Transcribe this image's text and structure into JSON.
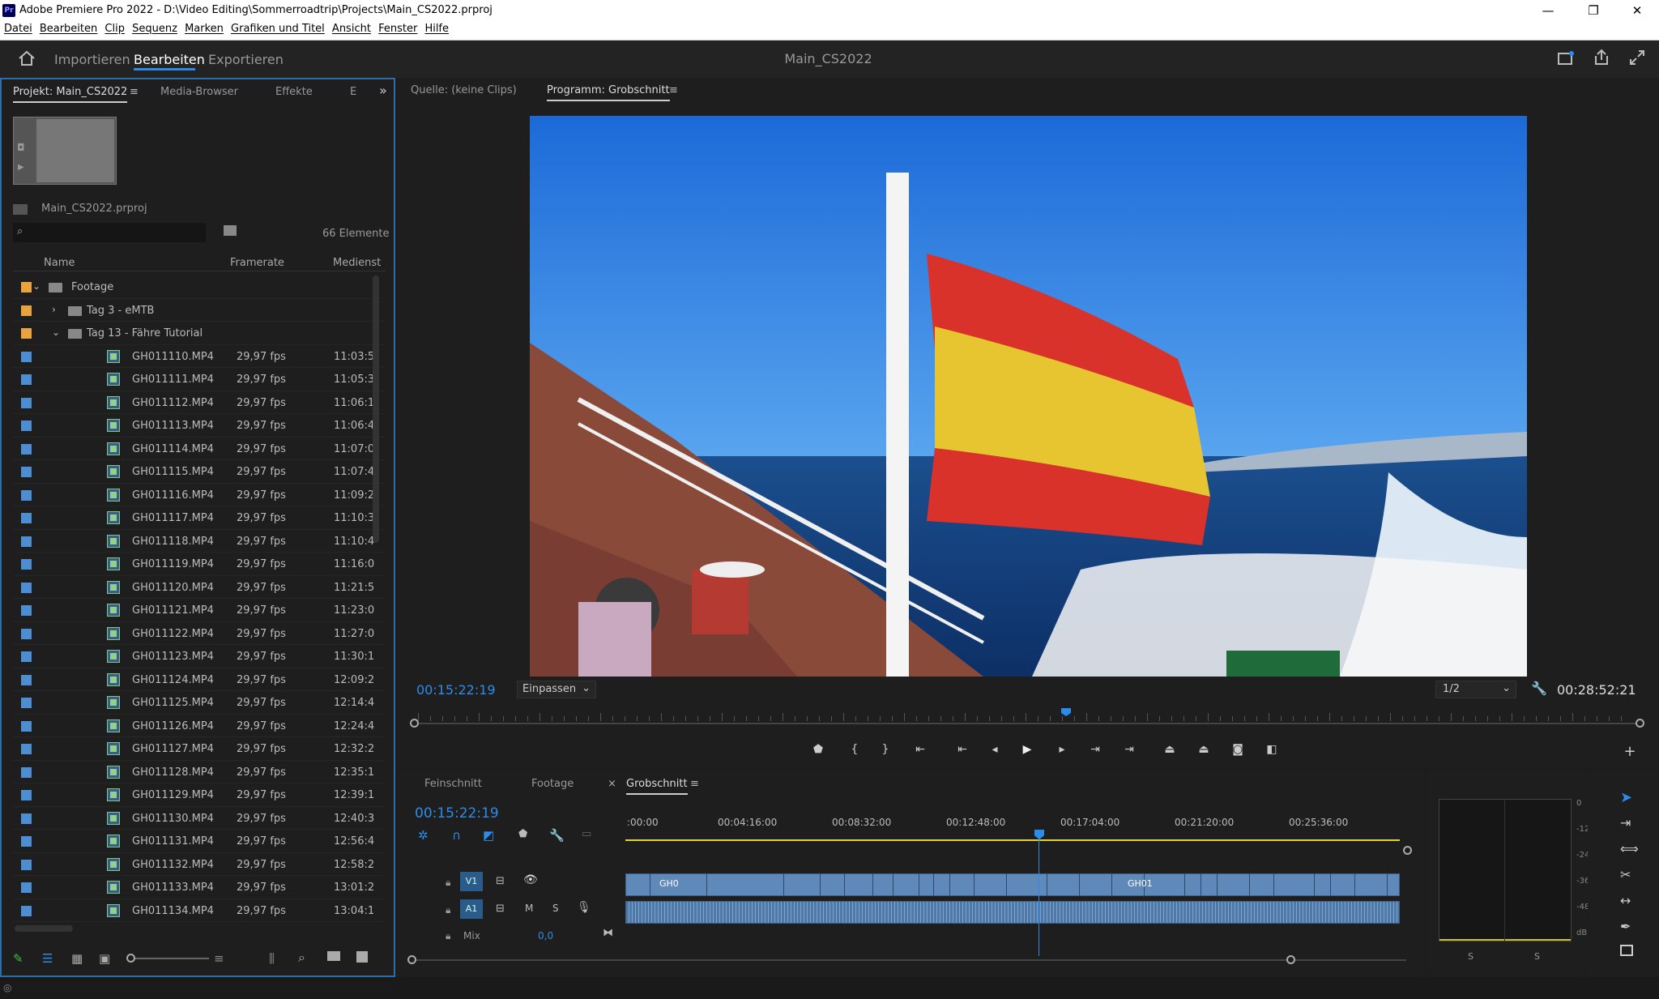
{
  "app": {
    "title": "Adobe Premiere Pro 2022 - D:\\Video Editing\\Sommerroadtrip\\Projects\\Main_CS2022.prproj",
    "logo_text": "Pr"
  },
  "window_controls": {
    "minimize": "—",
    "maximize": "❐",
    "close": "✕"
  },
  "menu": [
    "Datei",
    "Bearbeiten",
    "Clip",
    "Sequenz",
    "Marken",
    "Grafiken und Titel",
    "Ansicht",
    "Fenster",
    "Hilfe"
  ],
  "workspaces": {
    "import": "Importieren",
    "edit": "Bearbeiten",
    "export": "Exportieren"
  },
  "doc_title": "Main_CS2022",
  "project_panel": {
    "tabs": [
      "Projekt: Main_CS2022",
      "Media-Browser",
      "Effekte",
      "E"
    ],
    "project_file": "Main_CS2022.prproj",
    "search_placeholder": "",
    "item_count": "66 Elemente",
    "columns": {
      "name": "Name",
      "framerate": "Framerate",
      "media": "Mediensta"
    },
    "folders": [
      {
        "name": "Footage",
        "color": "#e8a33c"
      },
      {
        "name": "Tag 3 - eMTB",
        "color": "#e8a33c"
      },
      {
        "name": "Tag 13 - Fähre Tutorial",
        "color": "#e8a33c"
      }
    ],
    "clips": [
      {
        "name": "GH011110.MP4",
        "fps": "29,97 fps",
        "start": "11:03:5"
      },
      {
        "name": "GH011111.MP4",
        "fps": "29,97 fps",
        "start": "11:05:3"
      },
      {
        "name": "GH011112.MP4",
        "fps": "29,97 fps",
        "start": "11:06:1"
      },
      {
        "name": "GH011113.MP4",
        "fps": "29,97 fps",
        "start": "11:06:4"
      },
      {
        "name": "GH011114.MP4",
        "fps": "29,97 fps",
        "start": "11:07:0"
      },
      {
        "name": "GH011115.MP4",
        "fps": "29,97 fps",
        "start": "11:07:4"
      },
      {
        "name": "GH011116.MP4",
        "fps": "29,97 fps",
        "start": "11:09:2"
      },
      {
        "name": "GH011117.MP4",
        "fps": "29,97 fps",
        "start": "11:10:3"
      },
      {
        "name": "GH011118.MP4",
        "fps": "29,97 fps",
        "start": "11:10:4"
      },
      {
        "name": "GH011119.MP4",
        "fps": "29,97 fps",
        "start": "11:16:0"
      },
      {
        "name": "GH011120.MP4",
        "fps": "29,97 fps",
        "start": "11:21:5"
      },
      {
        "name": "GH011121.MP4",
        "fps": "29,97 fps",
        "start": "11:23:0"
      },
      {
        "name": "GH011122.MP4",
        "fps": "29,97 fps",
        "start": "11:27:0"
      },
      {
        "name": "GH011123.MP4",
        "fps": "29,97 fps",
        "start": "11:30:1"
      },
      {
        "name": "GH011124.MP4",
        "fps": "29,97 fps",
        "start": "12:09:2"
      },
      {
        "name": "GH011125.MP4",
        "fps": "29,97 fps",
        "start": "12:14:4"
      },
      {
        "name": "GH011126.MP4",
        "fps": "29,97 fps",
        "start": "12:24:4"
      },
      {
        "name": "GH011127.MP4",
        "fps": "29,97 fps",
        "start": "12:32:2"
      },
      {
        "name": "GH011128.MP4",
        "fps": "29,97 fps",
        "start": "12:35:1"
      },
      {
        "name": "GH011129.MP4",
        "fps": "29,97 fps",
        "start": "12:39:1"
      },
      {
        "name": "GH011130.MP4",
        "fps": "29,97 fps",
        "start": "12:40:3"
      },
      {
        "name": "GH011131.MP4",
        "fps": "29,97 fps",
        "start": "12:56:4"
      },
      {
        "name": "GH011132.MP4",
        "fps": "29,97 fps",
        "start": "12:58:2"
      },
      {
        "name": "GH011133.MP4",
        "fps": "29,97 fps",
        "start": "13:01:2"
      },
      {
        "name": "GH011134.MP4",
        "fps": "29,97 fps",
        "start": "13:04:1"
      }
    ]
  },
  "monitor": {
    "source_tab": "Quelle: (keine Clips)",
    "program_tab": "Programm: Grobschnitt",
    "current_tc": "00:15:22:19",
    "fit": "Einpassen",
    "resolution": "1/2",
    "duration_tc": "00:28:52:21"
  },
  "timeline": {
    "tabs": [
      "Feinschnitt",
      "Footage",
      "Grobschnitt"
    ],
    "current_tc": "00:15:22:19",
    "ruler": [
      ":00:00",
      "00:04:16:00",
      "00:08:32:00",
      "00:12:48:00",
      "00:17:04:00",
      "00:21:20:00",
      "00:25:36:00"
    ],
    "tracks": {
      "v1": "V1",
      "a1": "A1",
      "m": "M",
      "s": "S",
      "mix": "Mix",
      "mix_value": "0,0"
    },
    "clip_labels": [
      "GH0",
      "GH01"
    ]
  },
  "meter": {
    "scale": [
      "0",
      "-12",
      "-24",
      "-36",
      "-48",
      "dB"
    ],
    "solo_left": "S",
    "solo_right": "S"
  }
}
